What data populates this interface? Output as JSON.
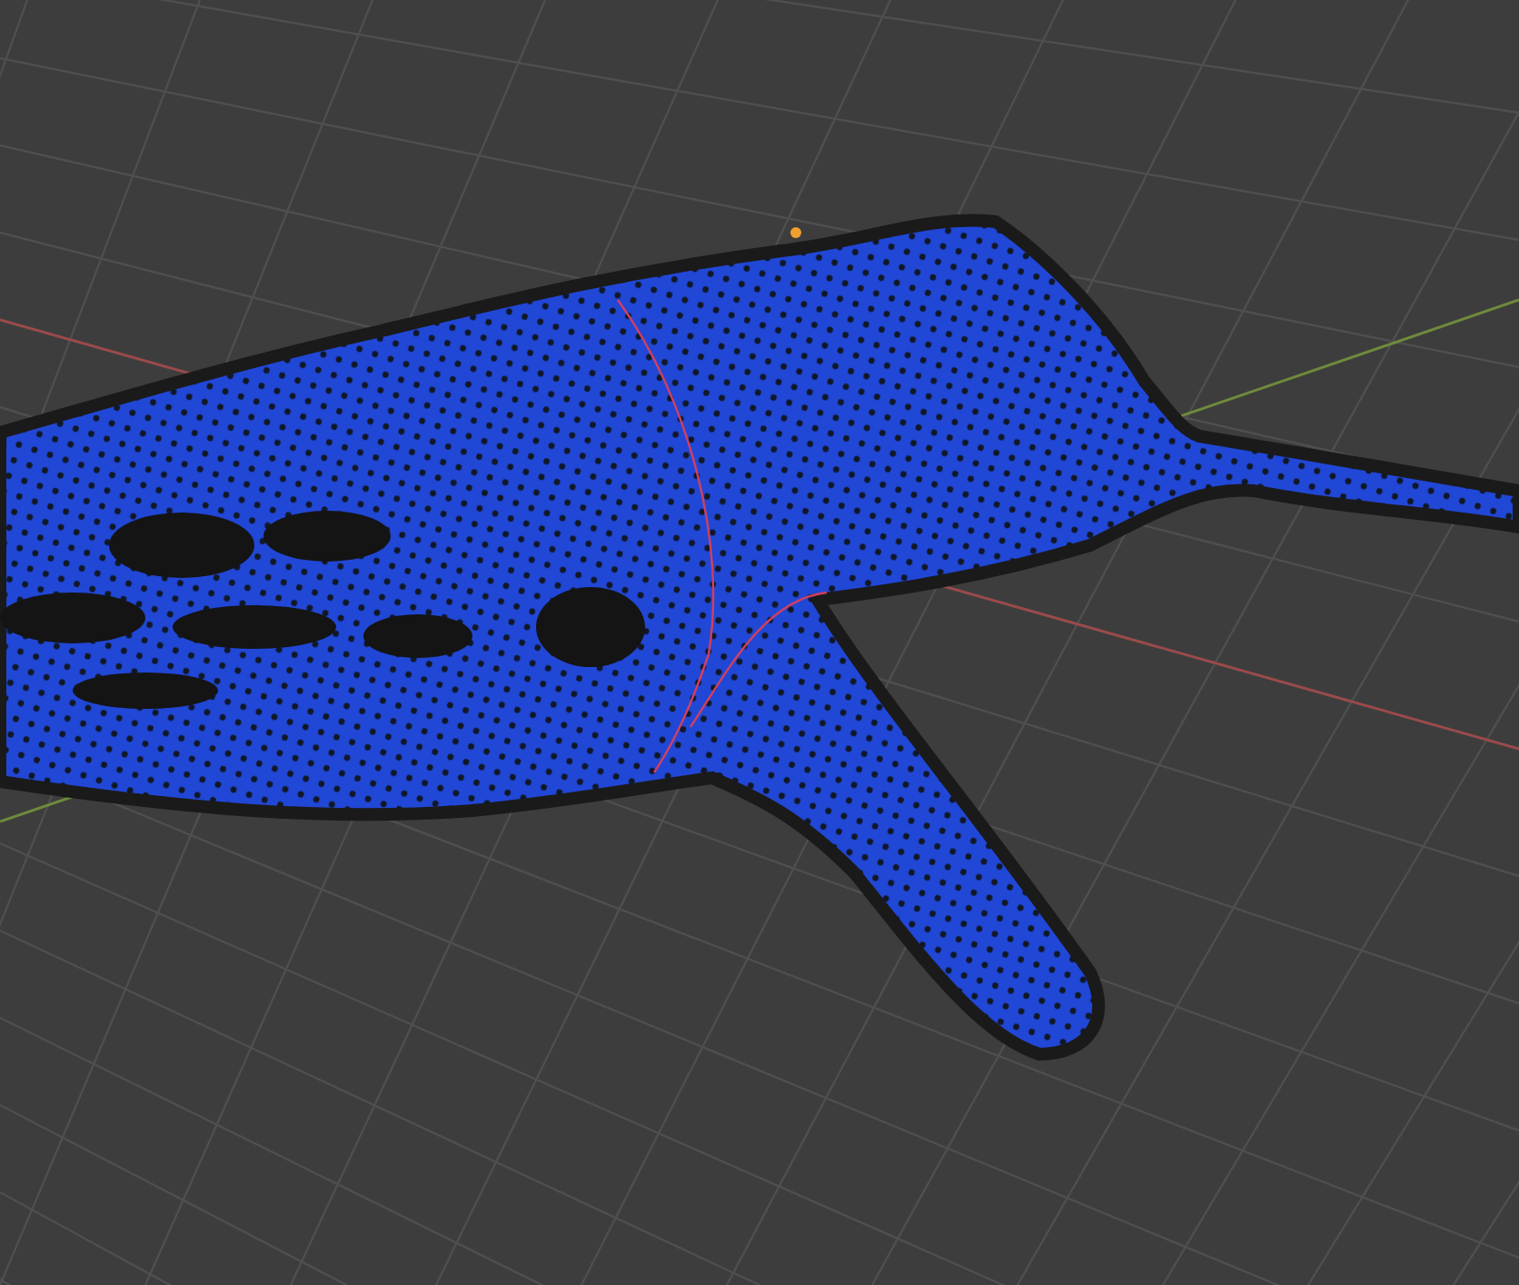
{
  "viewport": {
    "axes": [
      {
        "kind": "x",
        "color": "#9a4a4a"
      },
      {
        "kind": "y",
        "color": "#6f8a3c"
      }
    ]
  }
}
